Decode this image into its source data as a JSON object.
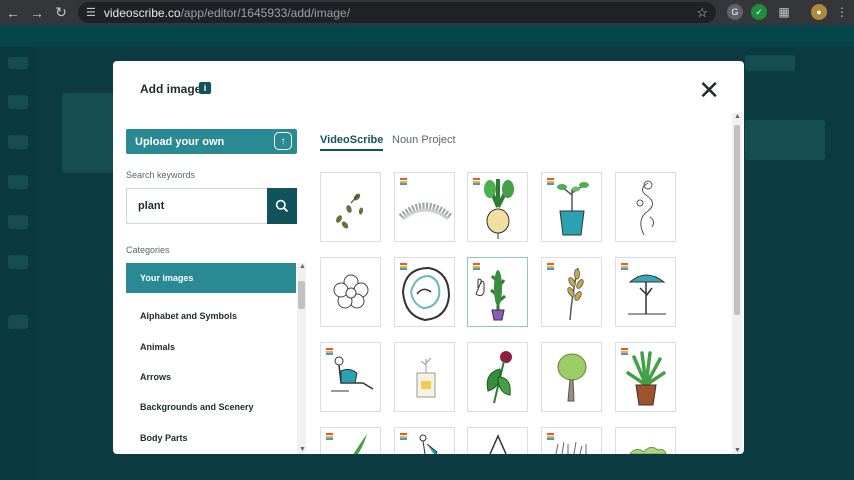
{
  "browser": {
    "url_host": "videoscribe.co",
    "url_path": "/app/editor/1645933/add/image/"
  },
  "modal": {
    "title": "Add image",
    "info": "i",
    "upload_label": "Upload your own",
    "search_caption": "Search keywords",
    "search_value": "plant",
    "categories_caption": "Categories",
    "categories": [
      "Your images",
      "Alphabet and Symbols",
      "Animals",
      "Arrows",
      "Backgrounds and Scenery",
      "Body Parts"
    ],
    "tabs": [
      "VideoScribe",
      "Noun Project"
    ],
    "images": [
      {
        "icon": "seeds-icon",
        "tag": false
      },
      {
        "icon": "wreath-icon",
        "tag": true
      },
      {
        "icon": "turnip-icon",
        "tag": true
      },
      {
        "icon": "potted-sapling-icon",
        "tag": true
      },
      {
        "icon": "vine-sketch-icon",
        "tag": false
      },
      {
        "icon": "flower-outline-icon",
        "tag": false
      },
      {
        "icon": "rock-plant-icon",
        "tag": true
      },
      {
        "icon": "potted-cactus-icon",
        "tag": true
      },
      {
        "icon": "wheat-stalk-icon",
        "tag": true
      },
      {
        "icon": "umbrella-tree-icon",
        "tag": true
      },
      {
        "icon": "person-gardening-icon",
        "tag": true
      },
      {
        "icon": "plant-in-jar-icon",
        "tag": false
      },
      {
        "icon": "rose-leaf-icon",
        "tag": false
      },
      {
        "icon": "green-tree-icon",
        "tag": true
      },
      {
        "icon": "aloe-pot-icon",
        "tag": true
      },
      {
        "icon": "grass-leaf-icon",
        "tag": true
      },
      {
        "icon": "watering-figure-icon",
        "tag": true
      },
      {
        "icon": "tent-sketch-icon",
        "tag": false
      },
      {
        "icon": "grass-tuft-icon",
        "tag": true
      },
      {
        "icon": "shrub-icon",
        "tag": false
      }
    ]
  },
  "colors": {
    "teal_dark": "#10535b",
    "teal": "#2a8a94",
    "tag_red": "#e8553b",
    "tag_yellow": "#f2b31b",
    "tag_blue": "#3d9cd8"
  }
}
